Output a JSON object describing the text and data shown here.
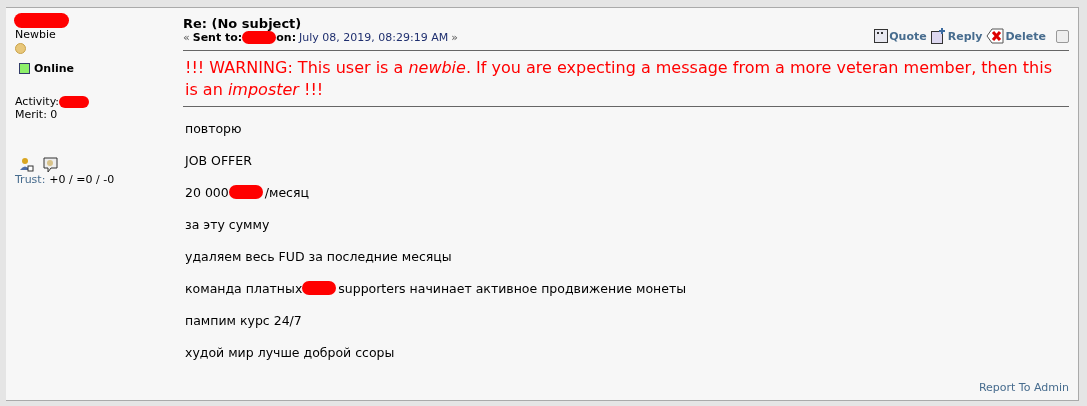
{
  "poster": {
    "rank": "Newbie",
    "status": "Online",
    "online": true,
    "activity_label": "Activity:",
    "merit": "Merit: 0",
    "trust_label": "Trust:",
    "trust_value": "+0 / =0 / -0"
  },
  "message": {
    "subject": "Re: (No subject)",
    "sent_open": "«",
    "sent_to_label": "Sent to:",
    "on_label": "on:",
    "date": "July 08, 2019, 08:29:19 AM",
    "sent_close": "»"
  },
  "actions": [
    {
      "kind": "quote",
      "label": "Quote"
    },
    {
      "kind": "reply",
      "label": "Reply"
    },
    {
      "kind": "delete",
      "label": "Delete"
    }
  ],
  "select_checked": false,
  "warning": "!!! WARNING: This user is a *newbie*. If you are expecting a message from a more veteran member, then this is an *imposter* !!!",
  "body": [
    [
      {
        "kind": "text",
        "text": "повторю"
      }
    ],
    [
      {
        "kind": "text",
        "text": "JOB OFFER"
      }
    ],
    [
      {
        "kind": "text",
        "text": "20 000"
      },
      {
        "kind": "redaction"
      },
      {
        "kind": "text",
        "text": "/месяц"
      }
    ],
    [
      {
        "kind": "text",
        "text": "за эту сумму"
      }
    ],
    [
      {
        "kind": "text",
        "text": "удаляем весь FUD за последние месяцы"
      }
    ],
    [
      {
        "kind": "text",
        "text": "команда платных"
      },
      {
        "kind": "redaction"
      },
      {
        "kind": "text",
        "text": "supporters начинает активное продвижение монеты"
      }
    ],
    [
      {
        "kind": "text",
        "text": "пампим курс 24/7"
      }
    ],
    [
      {
        "kind": "text",
        "text": "худой мир лучше доброй ссоры"
      }
    ]
  ],
  "report_link": "Report To Admin"
}
